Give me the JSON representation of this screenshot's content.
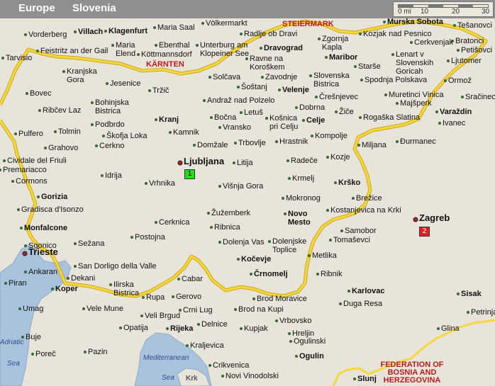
{
  "header": {
    "breadcrumb": [
      "Europe",
      "Slovenia"
    ],
    "scale": {
      "labels": [
        "0 mi",
        "10",
        "20",
        "30"
      ]
    }
  },
  "colors": {
    "land": "#e8e4da",
    "sea": "#a9c2de",
    "border": "#f6d73c",
    "border_edge": "#c8a81c",
    "region_label": "#b31b1b",
    "header": "#8f8f8f",
    "marker_ljubljana": "#22dd22",
    "marker_zagreb": "#dd2222"
  },
  "regions": [
    "STEIERMARK",
    "KÄRNTEN",
    "FEDERATION OF BOSNIA AND HERZEGOVINA"
  ],
  "water_labels": [
    "Adriatic",
    "Sea",
    "Mediterranean",
    "Sea",
    "Krk"
  ],
  "markers": [
    {
      "number": "1",
      "city": "Ljubljana"
    },
    {
      "number": "2",
      "city": "Zagreb"
    }
  ],
  "cities": [
    {
      "name": "Vorderberg"
    },
    {
      "name": "Villach"
    },
    {
      "name": "Klagenfurt"
    },
    {
      "name": "Maria Saal"
    },
    {
      "name": "Völkermarkt"
    },
    {
      "name": "Radlje ob Dravi"
    },
    {
      "name": "Zgornja Kapla"
    },
    {
      "name": "Kozjak nad Pesnico"
    },
    {
      "name": "Murska Sobota"
    },
    {
      "name": "Tešanovci"
    },
    {
      "name": "Tarvisio"
    },
    {
      "name": "Feistritz an der Gail"
    },
    {
      "name": "Maria Elend"
    },
    {
      "name": "Ebenthal"
    },
    {
      "name": "Köttmannsdorf"
    },
    {
      "name": "Unterburg am Klopeiner See"
    },
    {
      "name": "Dravograd"
    },
    {
      "name": "Maribor"
    },
    {
      "name": "Cerkvenjak"
    },
    {
      "name": "Bratonci"
    },
    {
      "name": "Petišovci"
    },
    {
      "name": "Ljutomer"
    },
    {
      "name": "Lenart v Slovenskih Goricah"
    },
    {
      "name": "Kranjska Gora"
    },
    {
      "name": "Ravne na Koroškem"
    },
    {
      "name": "Starše"
    },
    {
      "name": "Jesenice"
    },
    {
      "name": "Solčava"
    },
    {
      "name": "Zavodnje"
    },
    {
      "name": "Slovenska Bistrica"
    },
    {
      "name": "Spodnja Polskava"
    },
    {
      "name": "Ormož"
    },
    {
      "name": "Šoštanj"
    },
    {
      "name": "Tržič"
    },
    {
      "name": "Bovec"
    },
    {
      "name": "Velenje"
    },
    {
      "name": "Muretinci Vinica"
    },
    {
      "name": "Sračinec"
    },
    {
      "name": "Andraž nad Polzelo"
    },
    {
      "name": "Črešnjevec"
    },
    {
      "name": "Bohinjska Bistrica"
    },
    {
      "name": "Majšperk"
    },
    {
      "name": "Ribčev Laz"
    },
    {
      "name": "Dobrna"
    },
    {
      "name": "Letuš"
    },
    {
      "name": "Žiče"
    },
    {
      "name": "Varaždin"
    },
    {
      "name": "Kranj"
    },
    {
      "name": "Bočna"
    },
    {
      "name": "Celje"
    },
    {
      "name": "Rogaška Slatina"
    },
    {
      "name": "Podbrdo"
    },
    {
      "name": "Košnica pri Celju"
    },
    {
      "name": "Ivanec"
    },
    {
      "name": "Vransko"
    },
    {
      "name": "Tolmin"
    },
    {
      "name": "Kamnik"
    },
    {
      "name": "Pulfero"
    },
    {
      "name": "Kompolje"
    },
    {
      "name": "Škofja Loka"
    },
    {
      "name": "Hrastnik"
    },
    {
      "name": "Đurmanec"
    },
    {
      "name": "Grahovo"
    },
    {
      "name": "Cerkno"
    },
    {
      "name": "Domžale"
    },
    {
      "name": "Trbovlje"
    },
    {
      "name": "Miljana"
    },
    {
      "name": "Kozje"
    },
    {
      "name": "Cividale del Friuli"
    },
    {
      "name": "Ljubljana"
    },
    {
      "name": "Litija"
    },
    {
      "name": "Radeče"
    },
    {
      "name": "Premariacco"
    },
    {
      "name": "Idrija"
    },
    {
      "name": "Krmelj"
    },
    {
      "name": "Cormons"
    },
    {
      "name": "Vrhnika"
    },
    {
      "name": "Višnja Gora"
    },
    {
      "name": "Krško"
    },
    {
      "name": "Gorizia"
    },
    {
      "name": "Mokronog"
    },
    {
      "name": "Brežice"
    },
    {
      "name": "Gradisca d'Isonzo"
    },
    {
      "name": "Kostanjevica na Krki"
    },
    {
      "name": "Žužemberk"
    },
    {
      "name": "Novo Mesto"
    },
    {
      "name": "Zagreb"
    },
    {
      "name": "Cerknica"
    },
    {
      "name": "Monfalcone"
    },
    {
      "name": "Ribnica"
    },
    {
      "name": "Samobor"
    },
    {
      "name": "Postojna"
    },
    {
      "name": "Tomaševci"
    },
    {
      "name": "Sgonico"
    },
    {
      "name": "Sežana"
    },
    {
      "name": "Dolenja Vas"
    },
    {
      "name": "Dolenjske Toplice"
    },
    {
      "name": "Trieste"
    },
    {
      "name": "Kočevje"
    },
    {
      "name": "Metlika"
    },
    {
      "name": "Črnomelj"
    },
    {
      "name": "San Dorligo della Valle"
    },
    {
      "name": "Ankaran"
    },
    {
      "name": "Ribnik"
    },
    {
      "name": "Dekani"
    },
    {
      "name": "Cabar"
    },
    {
      "name": "Piran"
    },
    {
      "name": "Koper"
    },
    {
      "name": "Ilirska Bistrica"
    },
    {
      "name": "Brod Moravice"
    },
    {
      "name": "Karlovac"
    },
    {
      "name": "Sisak"
    },
    {
      "name": "Rupa"
    },
    {
      "name": "Gerovo"
    },
    {
      "name": "Duga Resa"
    },
    {
      "name": "Umag"
    },
    {
      "name": "Vele Mune"
    },
    {
      "name": "Brod na Kupi"
    },
    {
      "name": "Crni Lug"
    },
    {
      "name": "Petrinja"
    },
    {
      "name": "Veli Brgud"
    },
    {
      "name": "Vrbovsko"
    },
    {
      "name": "Opatija"
    },
    {
      "name": "Delnice"
    },
    {
      "name": "Kupjak"
    },
    {
      "name": "Glina"
    },
    {
      "name": "Rijeka"
    },
    {
      "name": "Hreljin"
    },
    {
      "name": "Ogulinski"
    },
    {
      "name": "Buje"
    },
    {
      "name": "Kraljevica"
    },
    {
      "name": "Poreč"
    },
    {
      "name": "Pazin"
    },
    {
      "name": "Ogulin"
    },
    {
      "name": "Crikvenica"
    },
    {
      "name": "Novi Vinodolski"
    },
    {
      "name": "Slunj"
    }
  ]
}
